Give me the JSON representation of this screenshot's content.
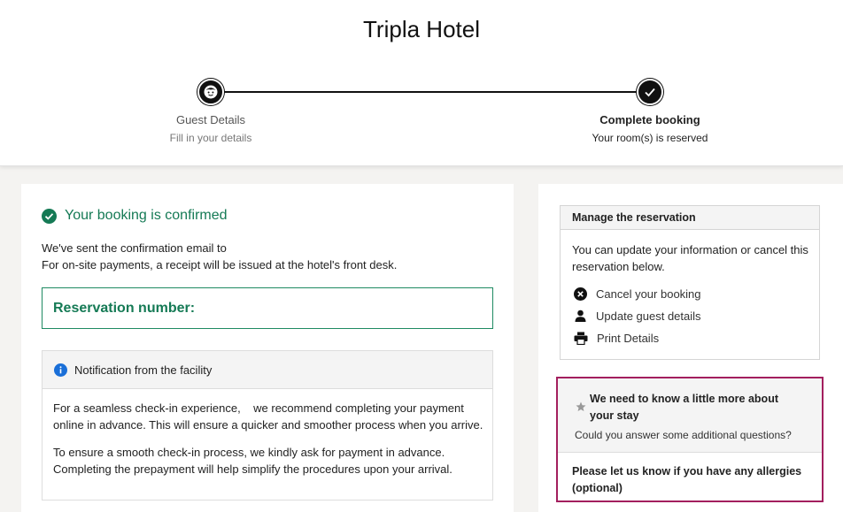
{
  "hotel": {
    "name": "Tripla Hotel"
  },
  "steps": [
    {
      "title": "Guest Details",
      "subtitle": "Fill in your details",
      "icon": "face-icon"
    },
    {
      "title": "Complete booking",
      "subtitle": "Your room(s) is reserved",
      "icon": "check-icon"
    }
  ],
  "confirmation": {
    "title": "Your booking is confirmed",
    "email_line": "We've sent the confirmation email to",
    "receipt_line": "For on-site payments, a receipt will be issued at the hotel's front desk.",
    "reservation_label": "Reservation number:"
  },
  "notification": {
    "title": "Notification from the facility",
    "paragraph1_line1": "For a seamless check-in experience,    we recommend completing your payment",
    "paragraph1_line2": "online in advance. This will ensure a quicker and smoother process when you arrive.",
    "paragraph2_line1": "To ensure a smooth check-in process, we kindly ask for payment in advance.",
    "paragraph2_line2": "Completing the prepayment will help simplify the procedures upon your arrival."
  },
  "manage": {
    "title": "Manage the reservation",
    "description": "You can update your information or cancel this reservation below.",
    "actions": [
      {
        "label": "Cancel your booking",
        "icon": "close-circle-icon"
      },
      {
        "label": "Update guest details",
        "icon": "person-icon"
      },
      {
        "label": "Print Details",
        "icon": "printer-icon"
      }
    ]
  },
  "questions": {
    "title": "We need to know a little more about your stay",
    "subtitle": "Could you answer some additional questions?",
    "allergy_label": "Please let us know if you have any allergies (optional)"
  },
  "colors": {
    "confirm_green": "#157a55",
    "highlight_border": "#a31f5e"
  }
}
